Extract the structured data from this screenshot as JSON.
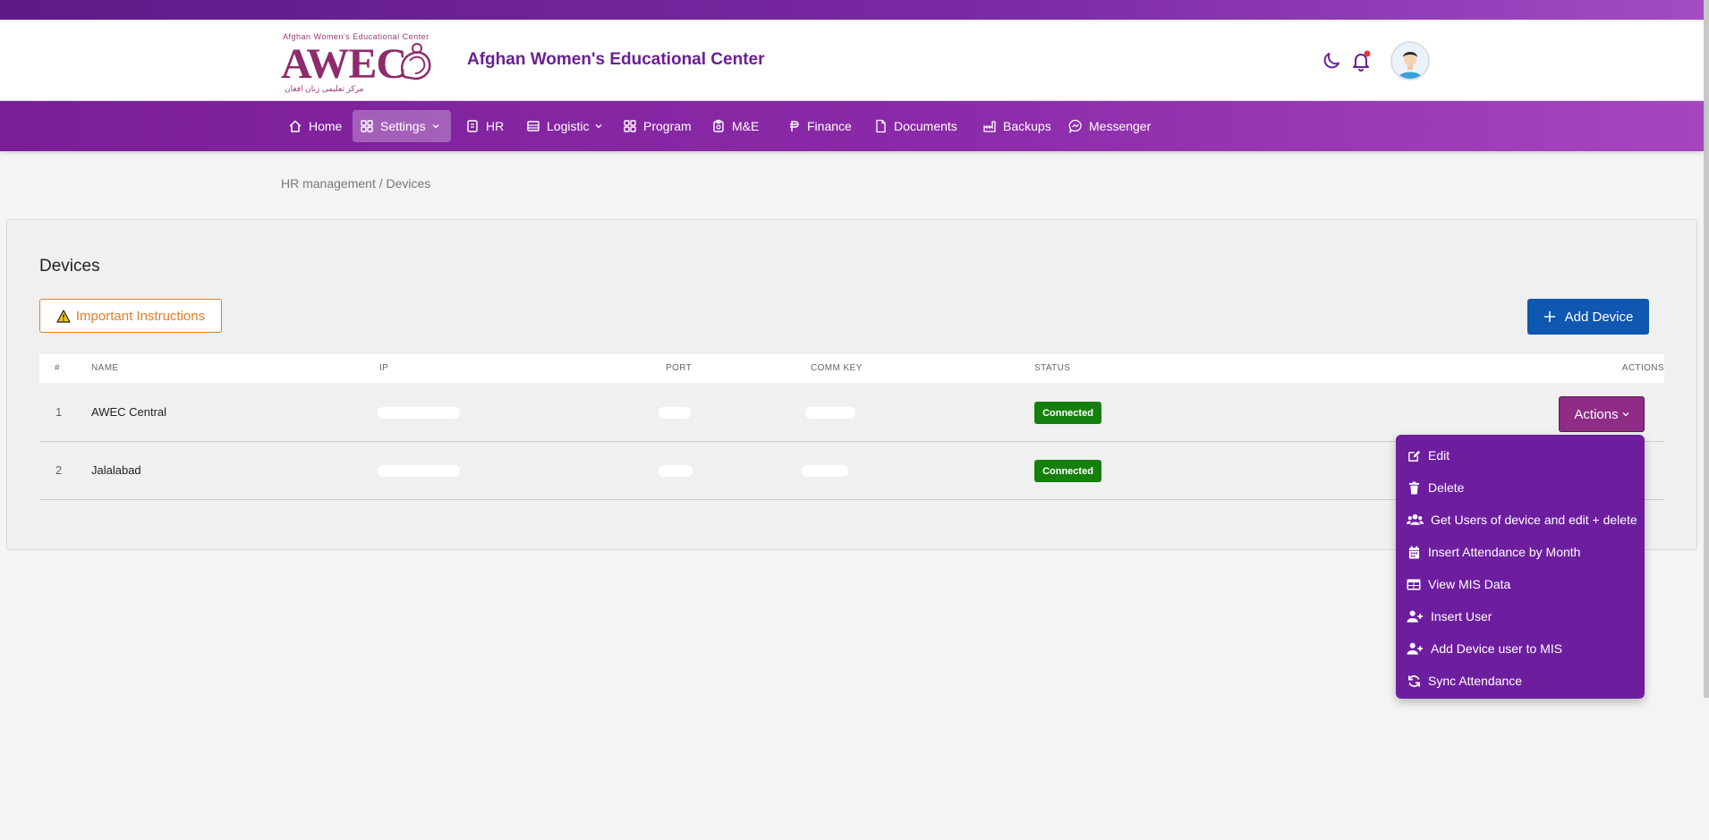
{
  "brand": {
    "logo_text": "AWEC",
    "logo_tagline": "Afghan Women's Educational Center",
    "logo_subtagline": "مرکز تعلیمی زنان افغان",
    "title": "Afghan Women's Educational Center"
  },
  "nav": {
    "home": "Home",
    "settings": "Settings",
    "hr": "HR",
    "logistic": "Logistic",
    "program": "Program",
    "me": "M&E",
    "finance": "Finance",
    "documents": "Documents",
    "backups": "Backups",
    "messenger": "Messenger"
  },
  "breadcrumb": "HR management / Devices",
  "page": {
    "title": "Devices",
    "instructions_button": "Important Instructions",
    "add_button": "Add Device"
  },
  "table": {
    "headers": {
      "num": "#",
      "name": "NAME",
      "ip": "IP",
      "port": "PORT",
      "comm_key": "COMM KEY",
      "status": "STATUS",
      "actions": "ACTIONS"
    },
    "rows": [
      {
        "num": "1",
        "name": "AWEC Central",
        "status": "Connected"
      },
      {
        "num": "2",
        "name": "Jalalabad",
        "status": "Connected"
      }
    ]
  },
  "actions": {
    "button": "Actions",
    "menu": [
      {
        "label": "Edit",
        "icon": "edit-icon"
      },
      {
        "label": "Delete",
        "icon": "trash-icon"
      },
      {
        "label": "Get Users of device and edit + delete",
        "icon": "users-icon"
      },
      {
        "label": "Insert Attendance by Month",
        "icon": "calendar-icon"
      },
      {
        "label": "View MIS Data",
        "icon": "table-icon"
      },
      {
        "label": "Insert User",
        "icon": "user-plus-icon"
      },
      {
        "label": "Add Device user to MIS",
        "icon": "user-plus-icon"
      },
      {
        "label": "Sync Attendance",
        "icon": "sync-icon"
      }
    ]
  },
  "colors": {
    "primary_purple": "#7a1e98",
    "add_button_blue": "#0f57b1",
    "status_green": "#15800e",
    "instructions_orange": "#e67e22",
    "menu_bg": "#6d1e9e"
  }
}
